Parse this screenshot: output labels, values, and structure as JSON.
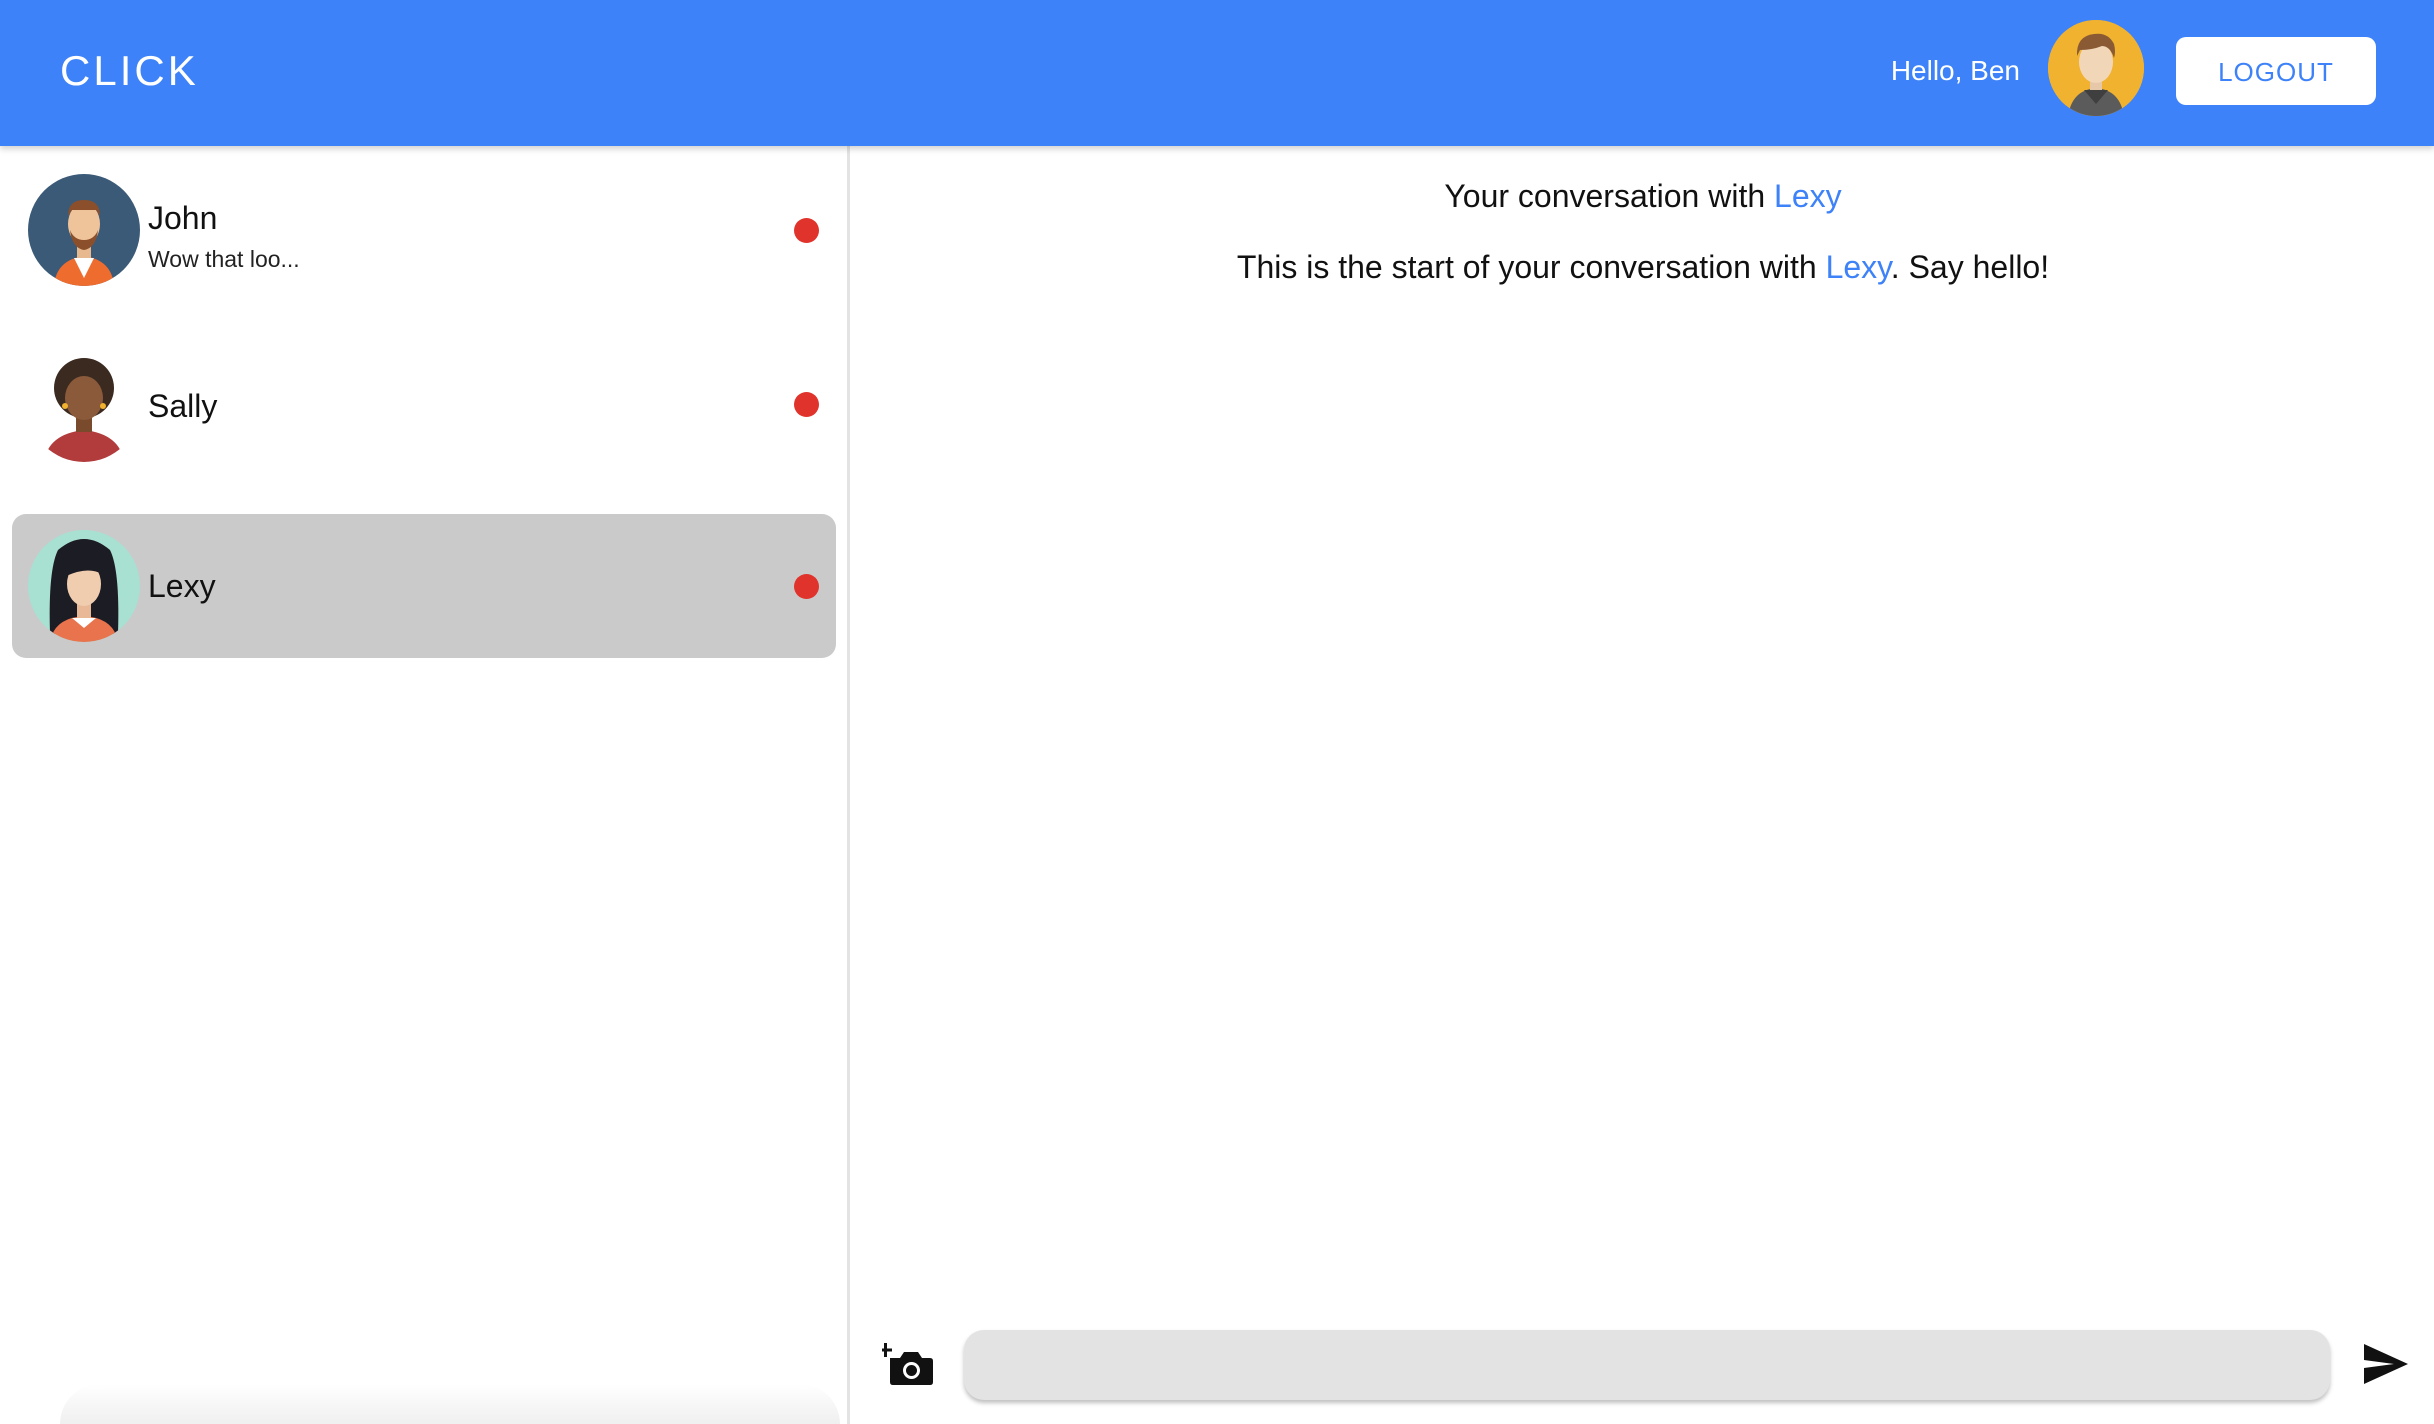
{
  "header": {
    "brand": "CLICK",
    "greeting": "Hello, Ben",
    "logout_label": "LOGOUT",
    "accent_color": "#3d82f8"
  },
  "contacts": [
    {
      "name": "John",
      "preview": "Wow that loo...",
      "unread": true,
      "selected": false,
      "avatar": "john-avatar"
    },
    {
      "name": "Sally",
      "preview": "",
      "unread": true,
      "selected": false,
      "avatar": "sally-avatar"
    },
    {
      "name": "Lexy",
      "preview": "",
      "unread": true,
      "selected": true,
      "avatar": "lexy-avatar"
    }
  ],
  "chat": {
    "title_prefix": "Your conversation with ",
    "partner": "Lexy",
    "intro_prefix": "This is the start of your conversation with ",
    "intro_suffix": ". Say hello!",
    "input_value": "",
    "input_placeholder": ""
  },
  "icons": {
    "camera": "add-photo-camera-icon",
    "send": "send-arrow-icon",
    "unread": "unread-dot"
  },
  "colors": {
    "unread_dot": "#e0332b",
    "selected_row": "#cacaca"
  }
}
